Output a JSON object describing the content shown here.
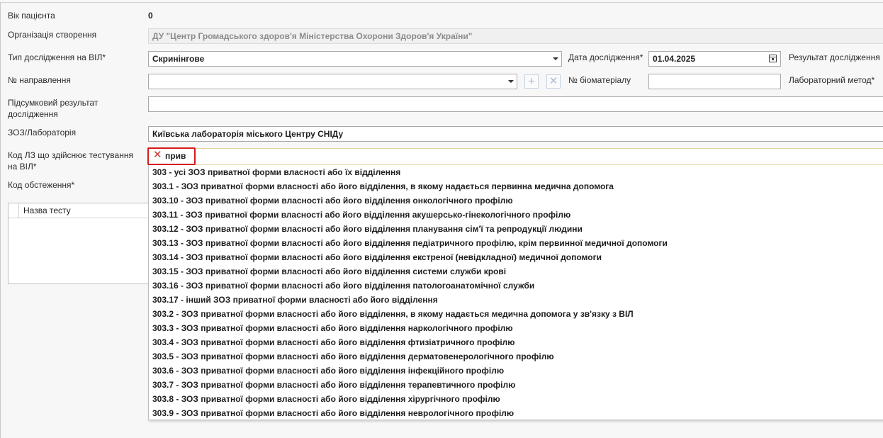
{
  "labels": {
    "patient_age": "Вік пацієнта",
    "organization": "Організація створення",
    "test_type": "Тип дослідження на ВІЛ*",
    "test_date": "Дата дослідження*",
    "result": "Результат дослідження",
    "referral_no": "№ направлення",
    "biomaterial_no": "№ біоматеріалу",
    "lab_method": "Лабораторний метод*",
    "final_result": "Підсумковий результат дослідження",
    "facility_lab": "ЗОЗ/Лабораторія",
    "facility_code": "Код ЛЗ що здійснює тестування на ВІЛ*",
    "exam_code": "Код обстеження*"
  },
  "values": {
    "patient_age": "0",
    "organization": "ДУ \"Центр Громадського здоров'я Міністерства Охорони Здоров'я України\"",
    "test_type": "Скринінгове",
    "test_date": "01.04.2025",
    "referral_no": "",
    "biomaterial_no": "",
    "final_result": "",
    "facility_lab": "Київська лабораторія міського Центру СНІДу"
  },
  "buttons": {
    "add": "+",
    "remove": "✕"
  },
  "grid": {
    "columns": [
      "Назва тесту"
    ]
  },
  "search": {
    "clear": "✕",
    "query": "прив"
  },
  "dropdown_items": [
    "303 - усі ЗОЗ приватної форми власності або їх відділення",
    "303.1 - ЗОЗ приватної форми власності або його відділення, в якому надається первинна медична допомога",
    "303.10 - ЗОЗ приватної форми власності або його відділення онкологічного профілю",
    "303.11 - ЗОЗ приватної форми власності або його відділення акушерсько-гінекологічного профілю",
    "303.12 - ЗОЗ приватної форми власності або його відділення планування сім'ї та репродукції людини",
    "303.13 - ЗОЗ приватної форми власності або його відділення педіатричного профілю, крім первинної медичної допомоги",
    "303.14 - ЗОЗ приватної форми власності або його відділення екстреної (невідкладної) медичної допомоги",
    "303.15 - ЗОЗ приватної форми власності або його відділення системи служби крові",
    "303.16 - ЗОЗ приватної форми власності або його відділення патологоанатомічної служби",
    "303.17 - інший ЗОЗ приватної форми власності або його відділення",
    "303.2 - ЗОЗ приватної форми власності або його відділення, в якому надається медична допомога у зв'язку з ВІЛ",
    "303.3 - ЗОЗ приватної форми власності або його відділення наркологічного профілю",
    "303.4 - ЗОЗ приватної форми власності або його відділення фтизіатричного профілю",
    "303.5 - ЗОЗ приватної форми власності або його відділення дерматовенерологічного профілю",
    "303.6 - ЗОЗ приватної форми власності або його відділення інфекційного профілю",
    "303.7 - ЗОЗ приватної форми власності або його відділення терапевтичного профілю",
    "303.8 - ЗОЗ приватної форми власності або його відділення хірургічного профілю",
    "303.9 - ЗОЗ приватної форми власності або його відділення неврологічного профілю"
  ]
}
